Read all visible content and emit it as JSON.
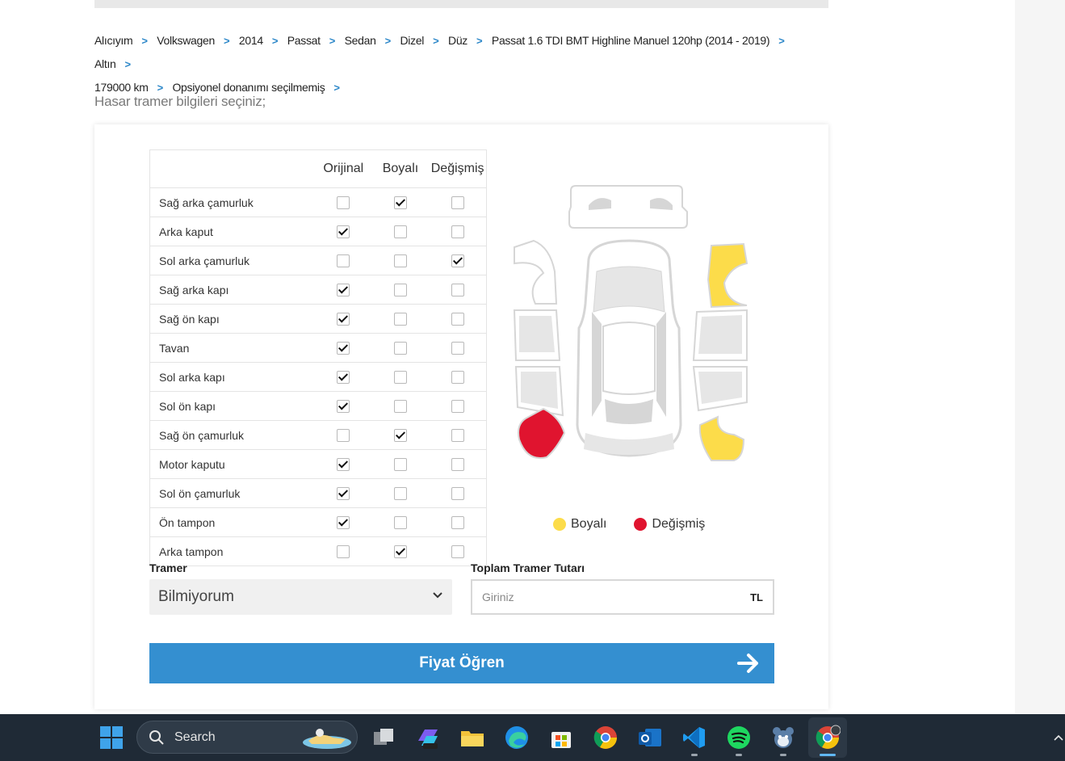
{
  "breadcrumb": [
    "Alıcıyım",
    "Volkswagen",
    "2014",
    "Passat",
    "Sedan",
    "Dizel",
    "Düz",
    "Passat 1.6 TDI BMT Highline Manuel 120hp (2014 - 2019)",
    "Altın",
    "179000 km",
    "Opsiyonel donanımı seçilmemiş"
  ],
  "section_title": "Hasar tramer bilgileri seçiniz;",
  "table": {
    "headers": [
      "Orijinal",
      "Boyalı",
      "Değişmiş"
    ],
    "rows": [
      {
        "label": "Sağ arka çamurluk",
        "state": "Boyalı"
      },
      {
        "label": "Arka kaput",
        "state": "Orijinal"
      },
      {
        "label": "Sol arka çamurluk",
        "state": "Değişmiş"
      },
      {
        "label": "Sağ arka kapı",
        "state": "Orijinal"
      },
      {
        "label": "Sağ ön kapı",
        "state": "Orijinal"
      },
      {
        "label": "Tavan",
        "state": "Orijinal"
      },
      {
        "label": "Sol arka kapı",
        "state": "Orijinal"
      },
      {
        "label": "Sol ön kapı",
        "state": "Orijinal"
      },
      {
        "label": "Sağ ön çamurluk",
        "state": "Boyalı"
      },
      {
        "label": "Motor kaputu",
        "state": "Orijinal"
      },
      {
        "label": "Sol ön çamurluk",
        "state": "Orijinal"
      },
      {
        "label": "Ön tampon",
        "state": "Orijinal"
      },
      {
        "label": "Arka tampon",
        "state": "Boyalı"
      }
    ]
  },
  "legend": {
    "painted": "Boyalı",
    "replaced": "Değişmiş"
  },
  "colors": {
    "painted": "#fcdc4a",
    "replaced": "#e0142f",
    "base": "#e8e8e8",
    "accent": "#348fd0"
  },
  "tramer": {
    "label": "Tramer",
    "value": "Bilmiyorum"
  },
  "total": {
    "label": "Toplam Tramer Tutarı",
    "placeholder": "Giriniz",
    "unit": "TL"
  },
  "cta": {
    "label": "Fiyat Öğren"
  },
  "taskbar": {
    "search_label": "Search"
  }
}
